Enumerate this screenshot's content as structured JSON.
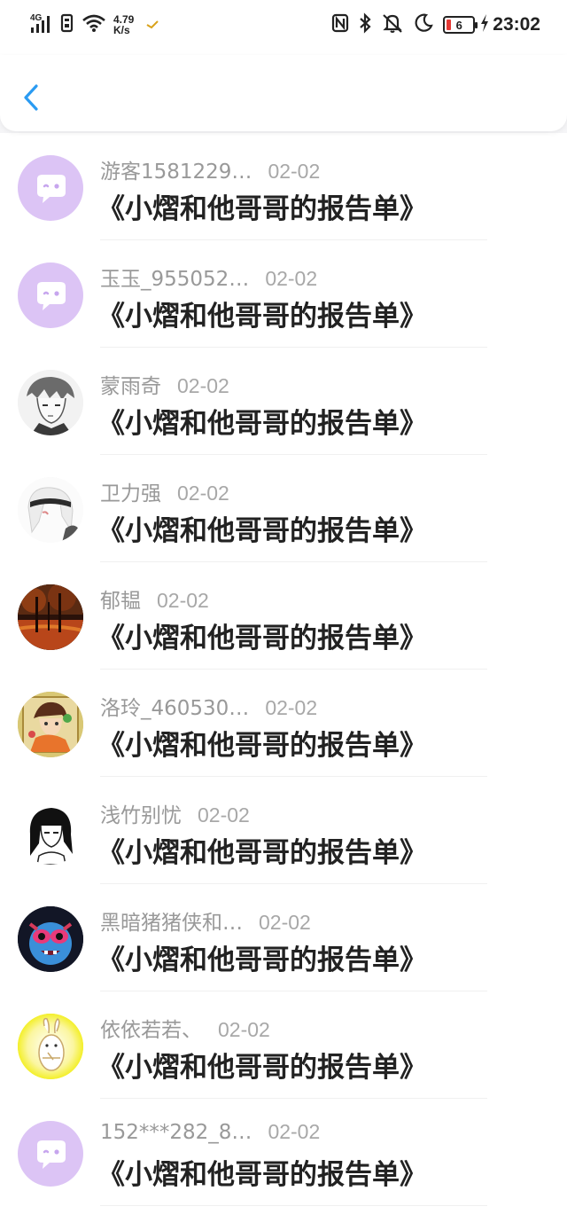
{
  "status_bar": {
    "signal": "4G",
    "speed_value": "4.79",
    "speed_unit": "K/s",
    "battery": "6",
    "time": "23:02",
    "colors": {
      "battery_low": "#e53935"
    }
  },
  "header": {
    "back_icon": "chevron-left-icon",
    "accent": "#2a9bf2"
  },
  "comments": [
    {
      "username": "游客1581229…",
      "date": "02-02",
      "message": "《小熠和他哥哥的报告单》",
      "avatar": "default-chat-avatar"
    },
    {
      "username": "玉玉_955052…",
      "date": "02-02",
      "message": "《小熠和他哥哥的报告单》",
      "avatar": "default-chat-avatar"
    },
    {
      "username": "蒙雨奇",
      "date": "02-02",
      "message": "《小熠和他哥哥的报告单》",
      "avatar": "anime-boy-sketch-avatar"
    },
    {
      "username": "卫力强",
      "date": "02-02",
      "message": "《小熠和他哥哥的报告单》",
      "avatar": "white-hair-anime-avatar"
    },
    {
      "username": "郁韫",
      "date": "02-02",
      "message": "《小熠和他哥哥的报告单》",
      "avatar": "autumn-forest-avatar"
    },
    {
      "username": "洛玲_460530…",
      "date": "02-02",
      "message": "《小熠和他哥哥的报告单》",
      "avatar": "anime-girl-colorful-avatar"
    },
    {
      "username": "浅竹别忧",
      "date": "02-02",
      "message": "《小熠和他哥哥的报告单》",
      "avatar": "black-hair-anime-avatar"
    },
    {
      "username": "黑暗猪猪侠和…",
      "date": "02-02",
      "message": "《小熠和他哥哥的报告单》",
      "avatar": "blue-cartoon-avatar"
    },
    {
      "username": "依依若若、",
      "date": "02-02",
      "message": "《小熠和他哥哥的报告单》",
      "avatar": "yellow-bunny-avatar"
    },
    {
      "username": "152***282_8…",
      "date": "02-02",
      "message": "《小熠和他哥哥的报告单》",
      "avatar": "default-chat-avatar"
    }
  ]
}
